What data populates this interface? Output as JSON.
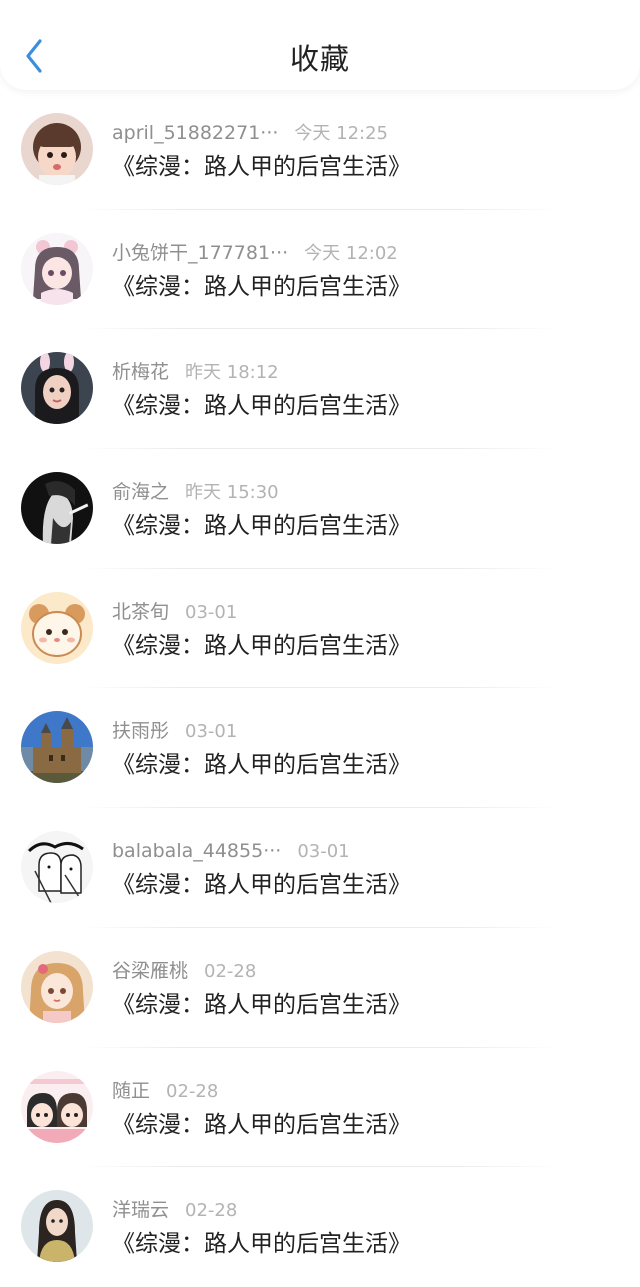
{
  "header": {
    "title": "收藏",
    "back_icon": "chevron-left-icon",
    "accent_color": "#3d8fdc"
  },
  "favorites": [
    {
      "name": "april_51882271···",
      "time": "今天 12:25",
      "book": "《综漫：路人甲的后宫生活》",
      "avatar_icon": "user-avatar-icon"
    },
    {
      "name": "小兔饼干_177781···",
      "time": "今天 12:02",
      "book": "《综漫：路人甲的后宫生活》",
      "avatar_icon": "user-avatar-icon"
    },
    {
      "name": "析梅花",
      "time": "昨天 18:12",
      "book": "《综漫：路人甲的后宫生活》",
      "avatar_icon": "user-avatar-icon"
    },
    {
      "name": "俞海之",
      "time": "昨天 15:30",
      "book": "《综漫：路人甲的后宫生活》",
      "avatar_icon": "user-avatar-icon"
    },
    {
      "name": "北茶旬",
      "time": "03-01",
      "book": "《综漫：路人甲的后宫生活》",
      "avatar_icon": "user-avatar-icon"
    },
    {
      "name": "扶雨彤",
      "time": "03-01",
      "book": "《综漫：路人甲的后宫生活》",
      "avatar_icon": "user-avatar-icon"
    },
    {
      "name": "balabala_44855···",
      "time": "03-01",
      "book": "《综漫：路人甲的后宫生活》",
      "avatar_icon": "user-avatar-icon"
    },
    {
      "name": "谷梁雁桃",
      "time": "02-28",
      "book": "《综漫：路人甲的后宫生活》",
      "avatar_icon": "user-avatar-icon"
    },
    {
      "name": "随正",
      "time": "02-28",
      "book": "《综漫：路人甲的后宫生活》",
      "avatar_icon": "user-avatar-icon"
    },
    {
      "name": "洋瑞云",
      "time": "02-28",
      "book": "《综漫：路人甲的后宫生活》",
      "avatar_icon": "user-avatar-icon"
    }
  ]
}
